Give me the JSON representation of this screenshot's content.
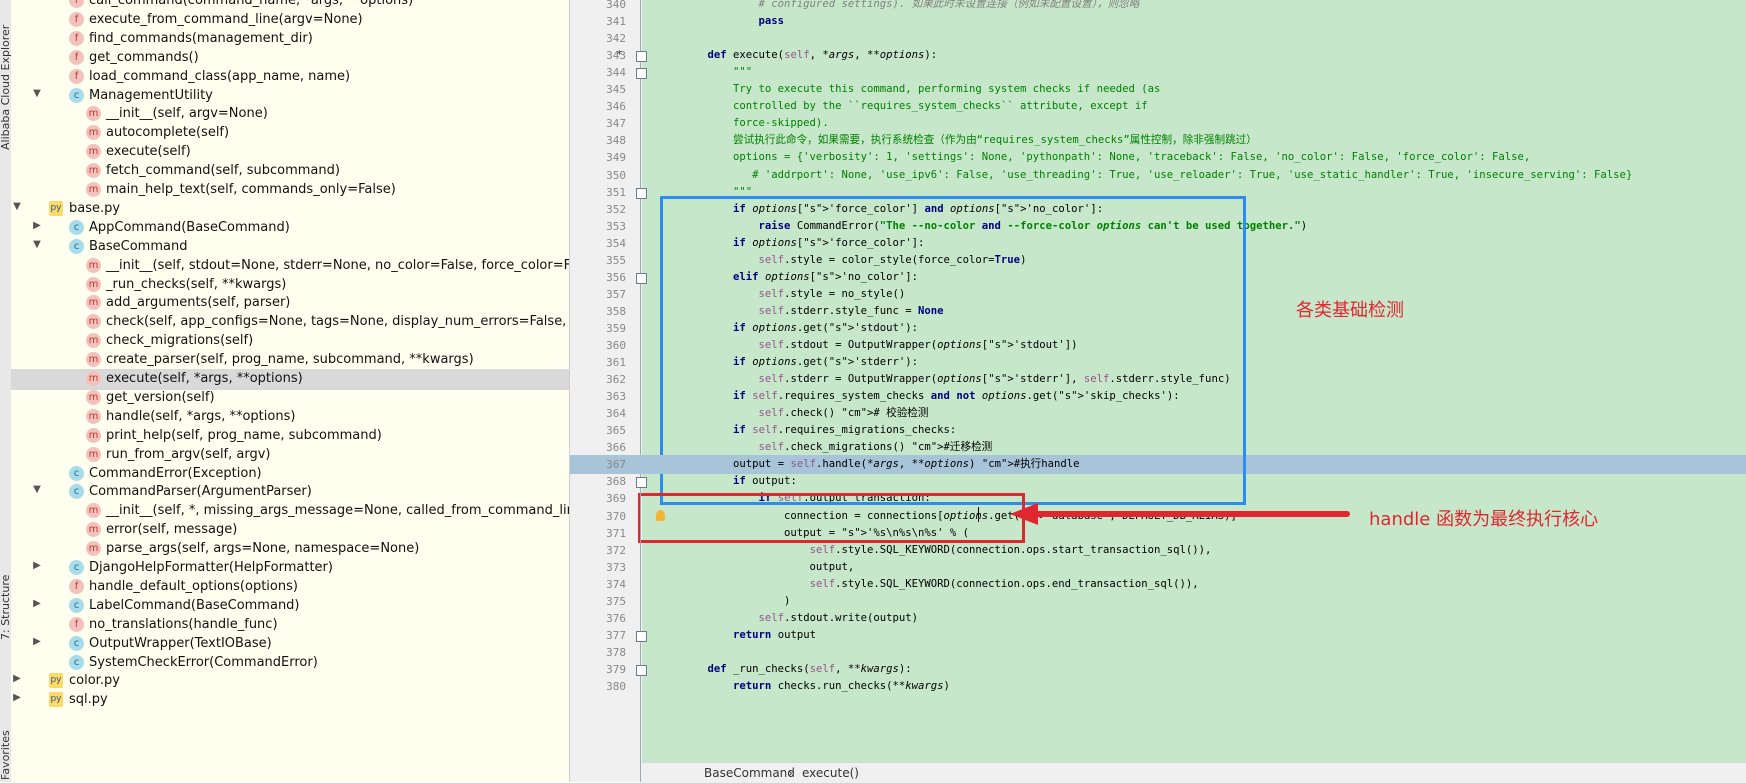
{
  "side_tabs": {
    "top": "Alibaba Cloud Explorer",
    "middle": "7: Structure",
    "bottom": "Favorites"
  },
  "tree": [
    {
      "type": "f",
      "indent": 2,
      "label": "call_command(command_name, *args, **options)"
    },
    {
      "type": "f",
      "indent": 2,
      "label": "execute_from_command_line(argv=None)"
    },
    {
      "type": "f",
      "indent": 2,
      "label": "find_commands(management_dir)"
    },
    {
      "type": "f",
      "indent": 2,
      "label": "get_commands()"
    },
    {
      "type": "f",
      "indent": 2,
      "label": "load_command_class(app_name, name)"
    },
    {
      "type": "c",
      "indent": 2,
      "label": "ManagementUtility",
      "arrow": "down"
    },
    {
      "type": "m",
      "indent": 3,
      "label": "__init__(self, argv=None)"
    },
    {
      "type": "m",
      "indent": 3,
      "label": "autocomplete(self)"
    },
    {
      "type": "m",
      "indent": 3,
      "label": "execute(self)"
    },
    {
      "type": "m",
      "indent": 3,
      "label": "fetch_command(self, subcommand)"
    },
    {
      "type": "m",
      "indent": 3,
      "label": "main_help_text(self, commands_only=False)"
    },
    {
      "type": "py",
      "indent": 1,
      "label": "base.py",
      "arrow": "down"
    },
    {
      "type": "c",
      "indent": 2,
      "label": "AppCommand(BaseCommand)",
      "arrow": "right"
    },
    {
      "type": "c",
      "indent": 2,
      "label": "BaseCommand",
      "arrow": "down"
    },
    {
      "type": "m",
      "indent": 3,
      "label": "__init__(self, stdout=None, stderr=None, no_color=False, force_color=False)"
    },
    {
      "type": "m",
      "indent": 3,
      "label": "_run_checks(self, **kwargs)"
    },
    {
      "type": "m",
      "indent": 3,
      "label": "add_arguments(self, parser)"
    },
    {
      "type": "m",
      "indent": 3,
      "label": "check(self, app_configs=None, tags=None, display_num_errors=False, include_"
    },
    {
      "type": "m",
      "indent": 3,
      "label": "check_migrations(self)"
    },
    {
      "type": "m",
      "indent": 3,
      "label": "create_parser(self, prog_name, subcommand, **kwargs)"
    },
    {
      "type": "m",
      "indent": 3,
      "label": "execute(self, *args, **options)",
      "selected": true
    },
    {
      "type": "m",
      "indent": 3,
      "label": "get_version(self)"
    },
    {
      "type": "m",
      "indent": 3,
      "label": "handle(self, *args, **options)"
    },
    {
      "type": "m",
      "indent": 3,
      "label": "print_help(self, prog_name, subcommand)"
    },
    {
      "type": "m",
      "indent": 3,
      "label": "run_from_argv(self, argv)"
    },
    {
      "type": "c",
      "indent": 2,
      "label": "CommandError(Exception)"
    },
    {
      "type": "c",
      "indent": 2,
      "label": "CommandParser(ArgumentParser)",
      "arrow": "down"
    },
    {
      "type": "m",
      "indent": 3,
      "label": "__init__(self, *, missing_args_message=None, called_from_command_line=None"
    },
    {
      "type": "m",
      "indent": 3,
      "label": "error(self, message)"
    },
    {
      "type": "m",
      "indent": 3,
      "label": "parse_args(self, args=None, namespace=None)"
    },
    {
      "type": "c",
      "indent": 2,
      "label": "DjangoHelpFormatter(HelpFormatter)",
      "arrow": "right"
    },
    {
      "type": "f",
      "indent": 2,
      "label": "handle_default_options(options)"
    },
    {
      "type": "c",
      "indent": 2,
      "label": "LabelCommand(BaseCommand)",
      "arrow": "right"
    },
    {
      "type": "f",
      "indent": 2,
      "label": "no_translations(handle_func)"
    },
    {
      "type": "c",
      "indent": 2,
      "label": "OutputWrapper(TextIOBase)",
      "arrow": "right"
    },
    {
      "type": "c",
      "indent": 2,
      "label": "SystemCheckError(CommandError)"
    },
    {
      "type": "py",
      "indent": 1,
      "label": "color.py",
      "arrow": "right"
    },
    {
      "type": "py",
      "indent": 1,
      "label": "sql.py",
      "arrow": "right"
    }
  ],
  "code": [
    {
      "n": "340",
      "t": "            # configured settings). 如果此时未设置连接（例如未配置设置），则忽略",
      "cls": "cm"
    },
    {
      "n": "341",
      "t": "            pass",
      "cls": "k"
    },
    {
      "n": "342",
      "t": ""
    },
    {
      "n": "343",
      "t": "    def execute(self, *args, **options):",
      "fold": true,
      "star": true
    },
    {
      "n": "344",
      "t": "        \"\"\"",
      "cls": "str-doc",
      "fold": true
    },
    {
      "n": "345",
      "t": "        Try to execute this command, performing system checks if needed (as",
      "cls": "str-doc"
    },
    {
      "n": "346",
      "t": "        controlled by the ``requires_system_checks`` attribute, except if",
      "cls": "str-doc"
    },
    {
      "n": "347",
      "t": "        force-skipped).",
      "cls": "str-doc"
    },
    {
      "n": "348",
      "t": "        尝试执行此命令，如果需要，执行系统检查（作为由“requires_system_checks”属性控制，除非强制跳过）",
      "cls": "str-doc"
    },
    {
      "n": "349",
      "t": "        options = {'verbosity': 1, 'settings': None, 'pythonpath': None, 'traceback': False, 'no_color': False, 'force_color': False,",
      "cls": "str-doc"
    },
    {
      "n": "350",
      "t": "           # 'addrport': None, 'use_ipv6': False, 'use_threading': True, 'use_reloader': True, 'use_static_handler': True, 'insecure_serving': False}",
      "cls": "str-doc"
    },
    {
      "n": "351",
      "t": "        \"\"\"",
      "cls": "str-doc",
      "fold": true
    },
    {
      "n": "352",
      "t": "        if options['force_color'] and options['no_color']:"
    },
    {
      "n": "353",
      "t": "            raise CommandError(\"The --no-color and --force-color options can't be used together.\")"
    },
    {
      "n": "354",
      "t": "        if options['force_color']:"
    },
    {
      "n": "355",
      "t": "            self.style = color_style(force_color=True)"
    },
    {
      "n": "356",
      "t": "        elif options['no_color']:",
      "fold": true
    },
    {
      "n": "357",
      "t": "            self.style = no_style()"
    },
    {
      "n": "358",
      "t": "            self.stderr.style_func = None"
    },
    {
      "n": "359",
      "t": "        if options.get('stdout'):"
    },
    {
      "n": "360",
      "t": "            self.stdout = OutputWrapper(options['stdout'])"
    },
    {
      "n": "361",
      "t": "        if options.get('stderr'):"
    },
    {
      "n": "362",
      "t": "            self.stderr = OutputWrapper(options['stderr'], self.stderr.style_func)"
    },
    {
      "n": "363",
      "t": "        if self.requires_system_checks and not options.get('skip_checks'):"
    },
    {
      "n": "364",
      "t": "            self.check() # 校验检测"
    },
    {
      "n": "365",
      "t": "        if self.requires_migrations_checks:"
    },
    {
      "n": "366",
      "t": "            self.check_migrations() #迁移检测"
    },
    {
      "n": "367",
      "t": "        output = self.handle(*args, **options) #执行handle",
      "hl": true
    },
    {
      "n": "368",
      "t": "        if output:",
      "fold": true
    },
    {
      "n": "369",
      "t": "            if self.output_transaction:"
    },
    {
      "n": "370",
      "t": "                connection = connections[options.get('database', DEFAULT_DB_ALIAS)]"
    },
    {
      "n": "371",
      "t": "                output = '%s\\n%s\\n%s' % ("
    },
    {
      "n": "372",
      "t": "                    self.style.SQL_KEYWORD(connection.ops.start_transaction_sql()),"
    },
    {
      "n": "373",
      "t": "                    output,"
    },
    {
      "n": "374",
      "t": "                    self.style.SQL_KEYWORD(connection.ops.end_transaction_sql()),"
    },
    {
      "n": "375",
      "t": "                )"
    },
    {
      "n": "376",
      "t": "            self.stdout.write(output)"
    },
    {
      "n": "377",
      "t": "        return output",
      "fold": true
    },
    {
      "n": "378",
      "t": ""
    },
    {
      "n": "379",
      "t": "    def _run_checks(self, **kwargs):",
      "fold": true
    },
    {
      "n": "380",
      "t": "        return checks.run_checks(**kwargs)"
    }
  ],
  "breadcrumb": {
    "cls": "BaseCommand",
    "sep": "›",
    "method": "execute()"
  },
  "annotations": {
    "blue_box_label": "各类基础检测",
    "red_box_label": "handle 函数为最终执行核心"
  },
  "colors": {
    "tree_bg": "#fffff0",
    "editor_bg": "#c7e7cb",
    "caret_row": "#a7c4d8",
    "annotation_red": "#e0262e",
    "annotation_blue": "#2d8cf0"
  }
}
